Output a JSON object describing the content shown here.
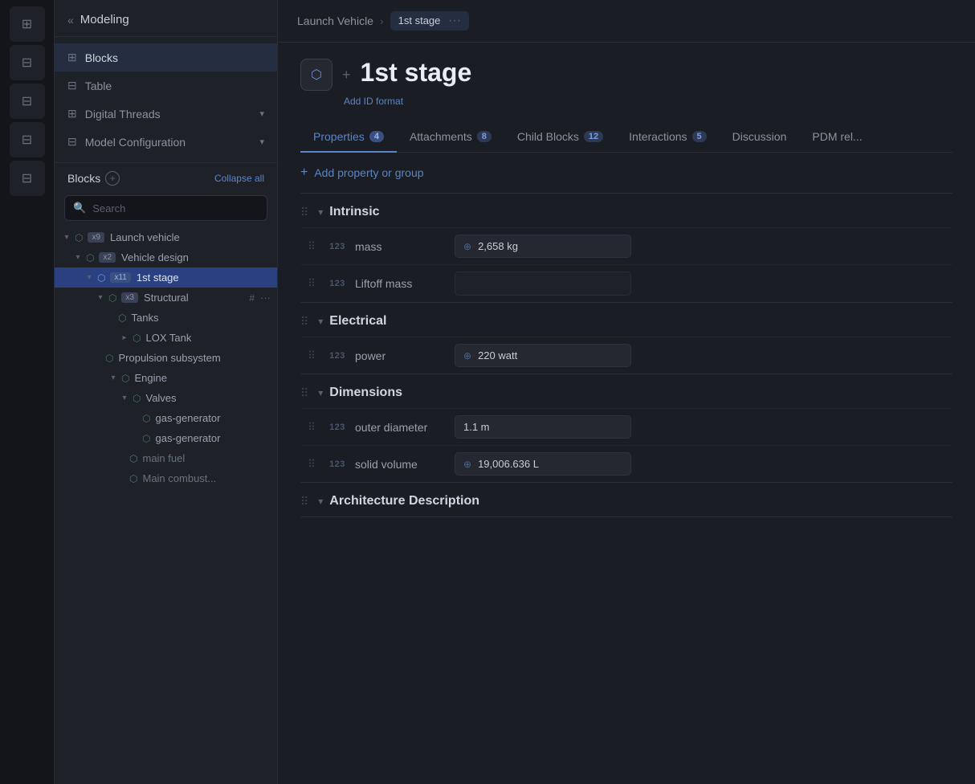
{
  "app": {
    "title": "Modeling"
  },
  "sidebar": {
    "nav_items": [
      {
        "id": "blocks",
        "label": "Blocks",
        "icon": "⊞",
        "active": true
      },
      {
        "id": "table",
        "label": "Table",
        "icon": "⊟"
      },
      {
        "id": "digital-threads",
        "label": "Digital Threads",
        "icon": "⊞",
        "has_arrow": true
      },
      {
        "id": "model-config",
        "label": "Model Configuration",
        "icon": "⊟",
        "has_arrow": true
      }
    ],
    "blocks_section": {
      "label": "Blocks",
      "collapse_all": "Collapse all"
    },
    "search": {
      "placeholder": "Search"
    },
    "tree": [
      {
        "id": "launch-vehicle",
        "label": "Launch vehicle",
        "badge": "x9",
        "depth": 0,
        "arrow": "▾",
        "icon": "⬡"
      },
      {
        "id": "vehicle-design",
        "label": "Vehicle design",
        "badge": "x2",
        "depth": 1,
        "arrow": "▾",
        "icon": "⬡"
      },
      {
        "id": "1st-stage",
        "label": "1st stage",
        "badge": "x11",
        "depth": 2,
        "arrow": "▾",
        "icon": "⬡",
        "selected": true
      },
      {
        "id": "structural",
        "label": "Structural",
        "badge": "x3",
        "depth": 3,
        "arrow": "▾",
        "icon": "⬡",
        "has_hash": true,
        "has_dots": true
      },
      {
        "id": "tanks",
        "label": "Tanks",
        "depth": 4,
        "arrow": "",
        "icon": "⬡"
      },
      {
        "id": "lox-tank",
        "label": "LOX Tank",
        "depth": 5,
        "arrow": "▸",
        "icon": "⬡"
      },
      {
        "id": "propulsion",
        "label": "Propulsion subsystem",
        "depth": 3,
        "arrow": "",
        "icon": "⬡"
      },
      {
        "id": "engine",
        "label": "Engine",
        "depth": 4,
        "arrow": "▾",
        "icon": "⬡"
      },
      {
        "id": "valves",
        "label": "Valves",
        "depth": 5,
        "arrow": "▾",
        "icon": "⬡"
      },
      {
        "id": "gas-gen-1",
        "label": "gas-generator",
        "depth": 6,
        "arrow": "",
        "icon": "⬡"
      },
      {
        "id": "gas-gen-2",
        "label": "gas-generator",
        "depth": 6,
        "arrow": "",
        "icon": "⬡"
      },
      {
        "id": "main-fuel",
        "label": "main fuel",
        "depth": 5,
        "arrow": "",
        "icon": "⬡"
      },
      {
        "id": "main-combust",
        "label": "Main combust...",
        "depth": 5,
        "arrow": "",
        "icon": "⬡"
      }
    ]
  },
  "breadcrumb": {
    "parent": "Launch Vehicle",
    "separator": "›",
    "current": "1st stage",
    "dots": "···"
  },
  "block": {
    "name": "1st stage",
    "add_id_format": "Add ID format"
  },
  "tabs": [
    {
      "id": "properties",
      "label": "Properties",
      "badge": "4",
      "active": true
    },
    {
      "id": "attachments",
      "label": "Attachments",
      "badge": "8"
    },
    {
      "id": "child-blocks",
      "label": "Child Blocks",
      "badge": "12"
    },
    {
      "id": "interactions",
      "label": "Interactions",
      "badge": "5"
    },
    {
      "id": "discussion",
      "label": "Discussion",
      "badge": ""
    },
    {
      "id": "pdm",
      "label": "PDM rel...",
      "badge": ""
    }
  ],
  "add_property": {
    "label": "Add property or group"
  },
  "property_groups": [
    {
      "id": "intrinsic",
      "label": "Intrinsic",
      "properties": [
        {
          "id": "mass",
          "type": "123",
          "name": "mass",
          "value": "2,658 kg",
          "has_icon": true
        },
        {
          "id": "liftoff-mass",
          "type": "123",
          "name": "Liftoff mass",
          "value": "",
          "has_icon": false
        }
      ]
    },
    {
      "id": "electrical",
      "label": "Electrical",
      "properties": [
        {
          "id": "power",
          "type": "123",
          "name": "power",
          "value": "220 watt",
          "has_icon": true
        }
      ]
    },
    {
      "id": "dimensions",
      "label": "Dimensions",
      "properties": [
        {
          "id": "outer-diameter",
          "type": "123",
          "name": "outer diameter",
          "value": "1.1 m",
          "has_icon": false
        },
        {
          "id": "solid-volume",
          "type": "123",
          "name": "solid volume",
          "value": "19,006.636 L",
          "has_icon": true
        }
      ]
    },
    {
      "id": "architecture",
      "label": "Architecture Description",
      "properties": []
    }
  ],
  "icons": {
    "drag": "⠿",
    "chevron_down": "▾",
    "chevron_right": "▸",
    "plus": "+",
    "search": "🔍",
    "block_icon": "⬡",
    "aggregate": "⊕",
    "back_arrows": "«"
  }
}
